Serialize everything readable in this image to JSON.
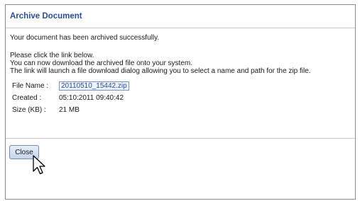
{
  "dialog": {
    "title": "Archive Document",
    "success_message": "Your document has been archived successfully.",
    "instructions": [
      "Please click the link below.",
      "You can now download the archived file onto your system.",
      "The link will launch a file download dialog allowing you to select a name and path for the zip file."
    ],
    "details": {
      "file_name_label": "File Name :",
      "file_name_value": "20110510_15442.zip",
      "created_label": "Created :",
      "created_value": "05:10:2011 09:40:42",
      "size_label": "Size (KB) :",
      "size_value": "21 MB"
    },
    "close_label": "Close"
  },
  "colors": {
    "title": "#2a4f8f",
    "link": "#2a4f8f",
    "border": "#8a8a8a"
  },
  "icons": {
    "cursor": "pointer-arrow-icon"
  }
}
